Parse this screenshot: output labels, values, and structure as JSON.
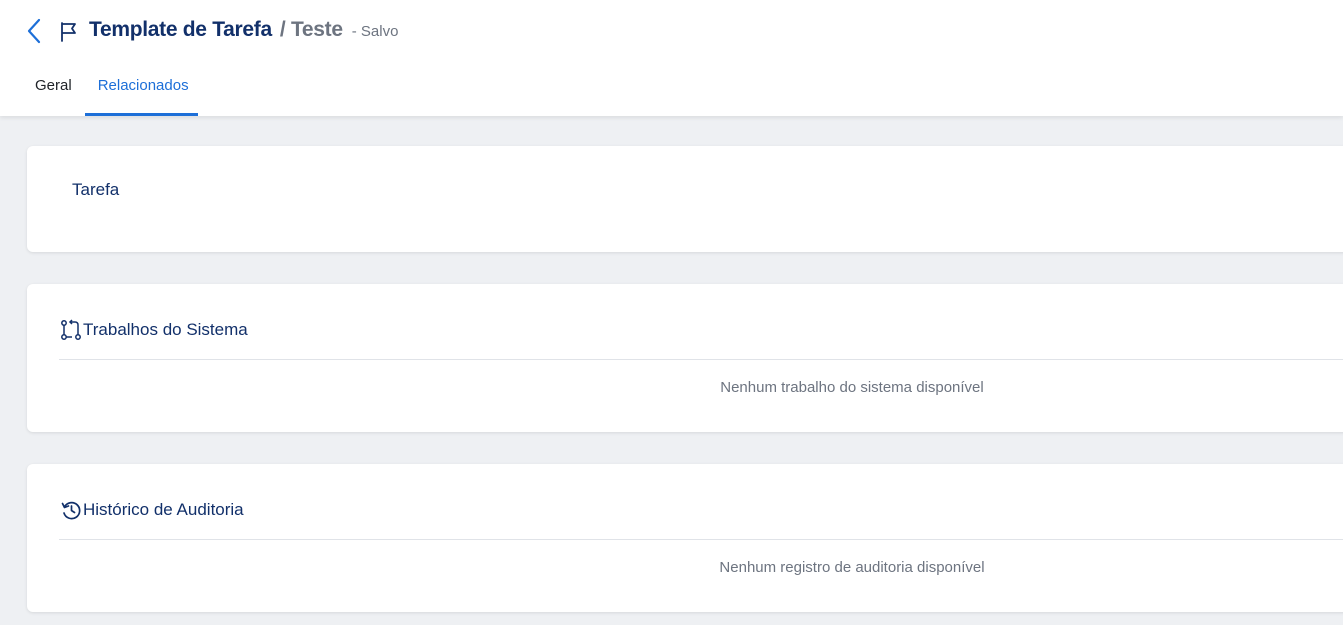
{
  "header": {
    "title": "Template de Tarefa",
    "subtitle": "/ Teste",
    "status": "- Salvo",
    "back_icon": "chevron-left-icon",
    "flag_icon": "flag-icon"
  },
  "tabs": [
    {
      "label": "Geral",
      "active": false
    },
    {
      "label": "Relacionados",
      "active": true
    }
  ],
  "sections": {
    "tarefa": {
      "title": "Tarefa"
    },
    "trabalhos": {
      "title": "Trabalhos do Sistema",
      "icon": "workflow-icon",
      "empty_message": "Nenhum trabalho do sistema disponível"
    },
    "auditoria": {
      "title": "Histórico de Auditoria",
      "icon": "history-icon",
      "empty_message": "Nenhum registro de auditoria disponível"
    }
  },
  "colors": {
    "primary": "#1d6fd8",
    "title": "#12306a",
    "muted": "#6d7480",
    "background": "#eef0f3"
  }
}
